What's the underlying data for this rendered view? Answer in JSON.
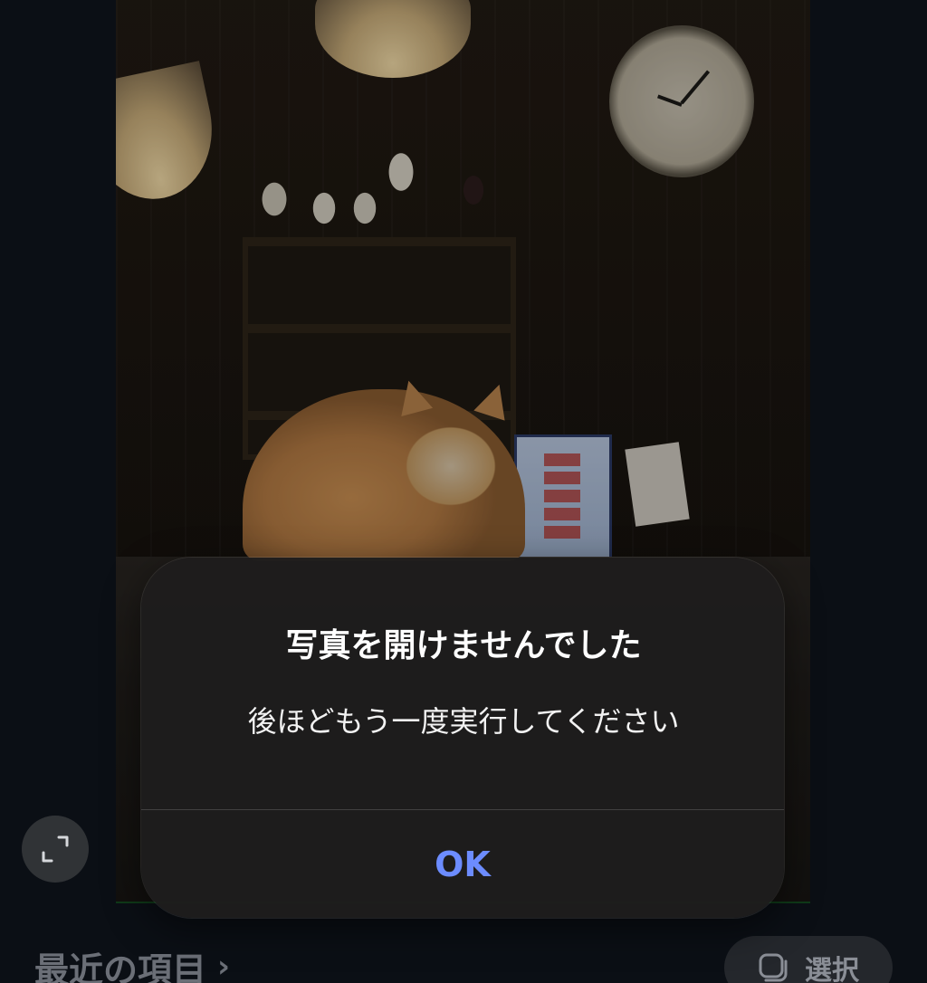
{
  "alert": {
    "title": "写真を開けませんでした",
    "message": "後ほどもう一度実行してください",
    "ok_label": "OK"
  },
  "bottom_bar": {
    "recent_label": "最近の項目",
    "recent_chevron": "›",
    "select_label": "選択"
  },
  "icons": {
    "expand": "expand-icon",
    "select": "select-icon",
    "chevron": "chevron-right-icon"
  },
  "colors": {
    "background": "#0b0f15",
    "alert_background": "#1e1d1d",
    "accent": "#6c8cff",
    "muted_text": "#6b6f77"
  }
}
